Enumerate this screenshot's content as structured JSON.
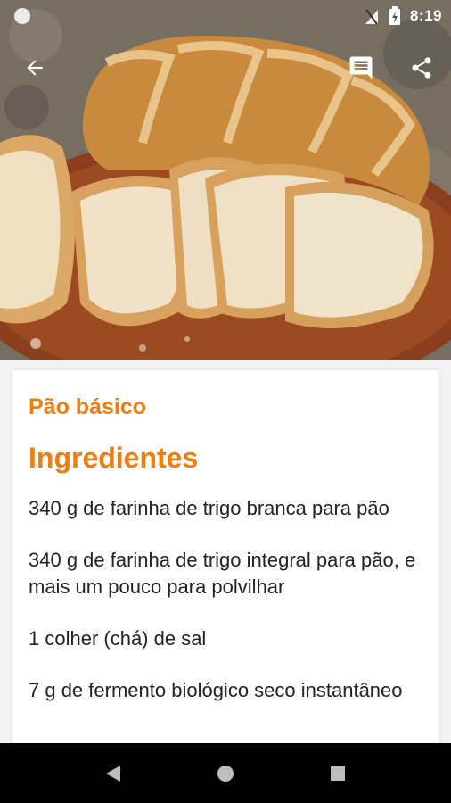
{
  "status_bar": {
    "time": "8:19",
    "icons": [
      "notification-dot-icon",
      "signal-off-icon",
      "battery-charging-icon"
    ]
  },
  "toolbar": {
    "back_icon": "arrow-back-icon",
    "comments_icon": "comment-icon",
    "share_icon": "share-icon"
  },
  "hero": {
    "subject": "bread-photo"
  },
  "recipe": {
    "title": "Pão básico",
    "section_title": "Ingredientes",
    "ingredients": [
      "340 g de farinha de trigo branca para pão",
      "340 g de farinha de trigo integral para pão, e mais um pouco para polvilhar",
      "1 colher (chá) de sal",
      "7 g de fermento biológico seco instantâneo"
    ]
  },
  "nav_bar": {
    "icons": [
      "nav-back-icon",
      "nav-home-icon",
      "nav-recents-icon"
    ]
  },
  "colors": {
    "accent": "#ef7d10",
    "text": "#222222",
    "nav_background": "#000000"
  }
}
